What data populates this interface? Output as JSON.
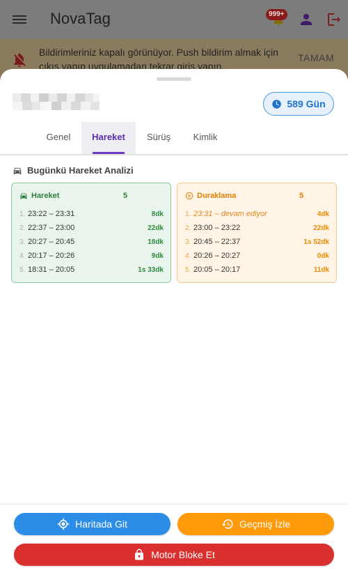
{
  "appbar": {
    "title": "NovaTag",
    "badge": "999+"
  },
  "notice": {
    "text": "Bildirimleriniz kapalı görünüyor. Push bildirim almak için çıkış yapıp uygulamadan tekrar giriş yapın.",
    "button": "TAMAM"
  },
  "sheet": {
    "days_chip": "589 Gün",
    "tabs": [
      {
        "label": "Genel",
        "active": false
      },
      {
        "label": "Hareket",
        "active": true
      },
      {
        "label": "Sürüş",
        "active": false
      },
      {
        "label": "Kimlik",
        "active": false
      }
    ],
    "section_title": "Bugünkü Hareket Analizi",
    "movement": {
      "title": "Hareket",
      "count": "5",
      "rows": [
        {
          "num": "1.",
          "time": "23:22 – 23:31",
          "dur": "8dk"
        },
        {
          "num": "2.",
          "time": "22:37 – 23:00",
          "dur": "22dk"
        },
        {
          "num": "3.",
          "time": "20:27 – 20:45",
          "dur": "18dk"
        },
        {
          "num": "4.",
          "time": "20:17 – 20:26",
          "dur": "9dk"
        },
        {
          "num": "5.",
          "time": "18:31 – 20:05",
          "dur": "1s 33dk"
        }
      ]
    },
    "stops": {
      "title": "Duraklama",
      "count": "5",
      "rows": [
        {
          "num": "1.",
          "time": "23:31 – devam ediyor",
          "dur": "4dk"
        },
        {
          "num": "2.",
          "time": "23:00 – 23:22",
          "dur": "22dk"
        },
        {
          "num": "3.",
          "time": "20:45 – 22:37",
          "dur": "1s 52dk"
        },
        {
          "num": "4.",
          "time": "20:26 – 20:27",
          "dur": "0dk"
        },
        {
          "num": "5.",
          "time": "20:05 – 20:17",
          "dur": "11dk"
        }
      ]
    }
  },
  "footer": {
    "map_button": "Haritada Git",
    "history_button": "Geçmiş İzle",
    "lock_button": "Motor Bloke Et"
  },
  "colors": {
    "accent_purple": "#6a3bbf",
    "map_blue": "#2b8de6",
    "history_orange": "#ff9a0a",
    "lock_red": "#d92f2f",
    "movement_green": "#2e7d3e",
    "stop_orange": "#e08000"
  }
}
